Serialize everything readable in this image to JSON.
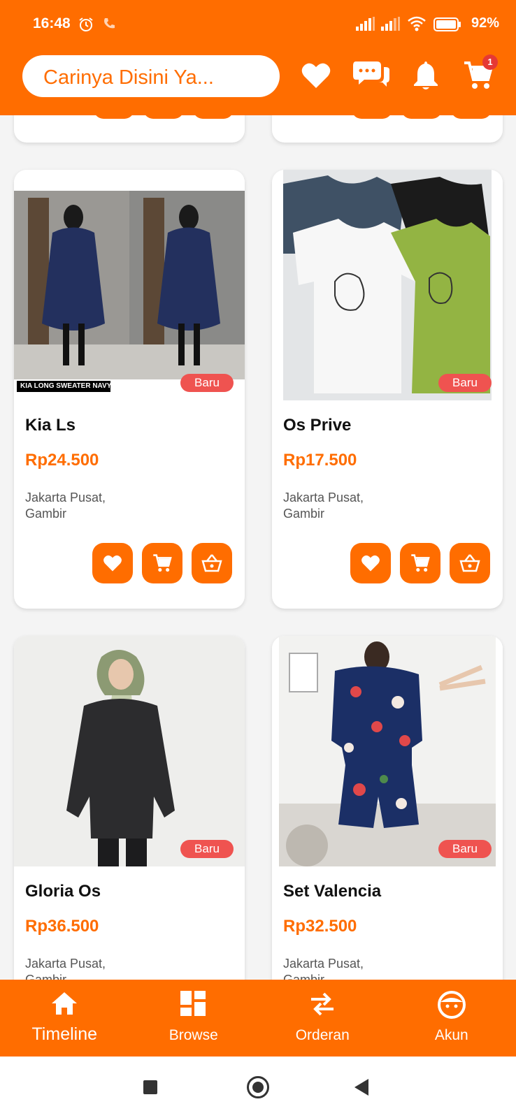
{
  "status_bar": {
    "time": "16:48",
    "battery": "92%"
  },
  "search": {
    "placeholder": "Carinya Disini Ya..."
  },
  "header": {
    "cart_count": "1"
  },
  "products": [
    {
      "name": "Kia Ls",
      "price": "Rp24.500",
      "location_line1": "Jakarta Pusat,",
      "location_line2": "Gambir",
      "badge": "Baru",
      "image_caption": "KIA LONG SWEATER NAVY"
    },
    {
      "name": "Os Prive",
      "price": "Rp17.500",
      "location_line1": "Jakarta Pusat,",
      "location_line2": "Gambir",
      "badge": "Baru"
    },
    {
      "name": "Gloria Os",
      "price": "Rp36.500",
      "location_line1": "Jakarta Pusat,",
      "location_line2": "Gambir",
      "badge": "Baru"
    },
    {
      "name": "Set Valencia",
      "price": "Rp32.500",
      "location_line1": "Jakarta Pusat,",
      "location_line2": "Gambir",
      "badge": "Baru"
    }
  ],
  "bottom_nav": [
    {
      "label": "Timeline",
      "icon": "home-icon",
      "active": true
    },
    {
      "label": "Browse",
      "icon": "grid-icon"
    },
    {
      "label": "Orderan",
      "icon": "swap-icon"
    },
    {
      "label": "Akun",
      "icon": "face-icon"
    }
  ],
  "colors": {
    "accent": "#ff6d00",
    "badge": "#ef5350"
  }
}
